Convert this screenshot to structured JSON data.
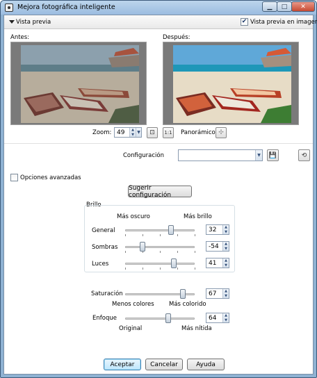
{
  "window": {
    "title": "Mejora fotográfica inteligente"
  },
  "preview_section": {
    "label": "Vista previa",
    "image_preview_label": "Vista previa en imagen",
    "image_preview_checked": true,
    "before_label": "Antes:",
    "after_label": "Después:"
  },
  "zoom": {
    "label": "Zoom:",
    "value": "49",
    "pan_label": "Panorámico:"
  },
  "config": {
    "label": "Configuración",
    "value": ""
  },
  "advanced": {
    "label": "Opciones avanzadas",
    "checked": false
  },
  "suggest_button": "Sugerir configuración",
  "brightness": {
    "group_label": "Brillo",
    "dark_label": "Más oscuro",
    "bright_label": "Más brillo",
    "rows": [
      {
        "label": "General",
        "value": 32,
        "level": 0.66
      },
      {
        "label": "Sombras",
        "value": -54,
        "level": 0.25
      },
      {
        "label": "Luces",
        "value": 41,
        "level": 0.7
      }
    ]
  },
  "saturation": {
    "label": "Saturación",
    "value": 67,
    "level": 0.83,
    "min_label": "Menos colores",
    "max_label": "Más colorido"
  },
  "focus": {
    "label": "Enfoque",
    "value": 64,
    "level": 0.62,
    "min_label": "Original",
    "max_label": "Más nítida"
  },
  "footer": {
    "ok": "Aceptar",
    "cancel": "Cancelar",
    "help": "Ayuda"
  },
  "icons": {
    "window_icon": "camera-icon",
    "minimize": "minimize-icon",
    "maximize": "maximize-icon",
    "close": "close-icon",
    "collapse": "triangle-down-icon",
    "zoom_fit": "zoom-fit-icon",
    "zoom_actual": "zoom-actual-size-icon",
    "pan": "pan-icon",
    "save_preset": "save-icon",
    "reset": "reset-icon"
  }
}
